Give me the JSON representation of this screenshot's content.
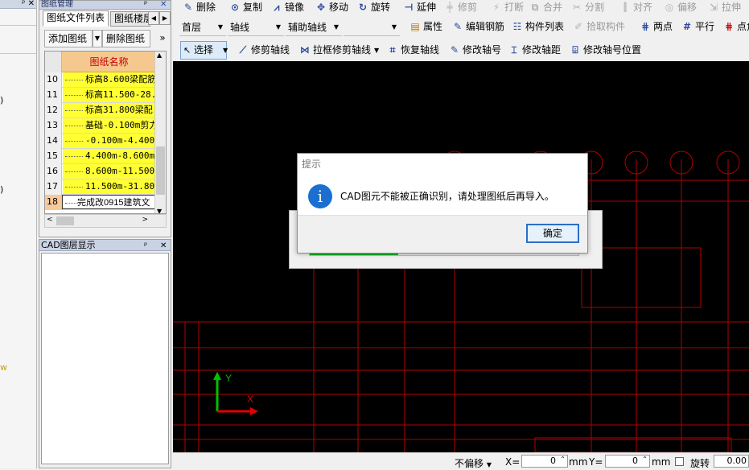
{
  "left_panel": {
    "fragments": [
      ")",
      ")",
      "w"
    ]
  },
  "drawing_panel": {
    "title": "图纸管理",
    "pin": "ᵖ",
    "close": "✕",
    "tabs": [
      "图纸文件列表",
      "图纸楼层"
    ],
    "add_label": "添加图纸",
    "delete_label": "删除图纸",
    "more": "»",
    "header": "图纸名称",
    "rows": [
      {
        "num": "10",
        "name": "标高8.600梁配筋"
      },
      {
        "num": "11",
        "name": "标高11.500-28."
      },
      {
        "num": "12",
        "name": "标高31.800梁配"
      },
      {
        "num": "13",
        "name": "基础-0.100m剪力"
      },
      {
        "num": "14",
        "name": "-0.100m-4.400M"
      },
      {
        "num": "15",
        "name": "4.400m-8.600m剪"
      },
      {
        "num": "16",
        "name": "8.600m-11.500m"
      },
      {
        "num": "17",
        "name": "11.500m-31.800"
      },
      {
        "num": "18",
        "name": "完成改0915建筑文"
      }
    ]
  },
  "layer_panel": {
    "title": "CAD图层显示"
  },
  "toolbar1": {
    "items": [
      "删除",
      "复制",
      "镜像",
      "移动",
      "旋转",
      "延伸",
      "修剪",
      "打断",
      "合并",
      "分割",
      "对齐",
      "偏移",
      "拉伸"
    ]
  },
  "toolbar2": {
    "floor": "首层",
    "category": "轴线",
    "type": "辅助轴线",
    "blank": "",
    "items": [
      "属性",
      "编辑钢筋",
      "构件列表",
      "拾取构件",
      "两点",
      "平行",
      "点角"
    ]
  },
  "toolbar3": {
    "select": "选择",
    "items": [
      "修剪轴线",
      "拉框修剪轴线",
      "恢复轴线",
      "修改轴号",
      "修改轴距",
      "修改轴号位置"
    ]
  },
  "canvas": {
    "axis_x": "X",
    "axis_y": "Y"
  },
  "dialog": {
    "title": "提示",
    "message": "CAD图元不能被正确识别，请处理图纸后再导入。",
    "ok": "确定"
  },
  "progress": {
    "value": 0.33
  },
  "status": {
    "mode": "不偏移",
    "x_label": "X=",
    "x_value": "0",
    "unit1": "mm",
    "y_label": "Y=",
    "y_value": "0",
    "unit2": "mm",
    "rotate_label": "旋转",
    "rotate_value": "0.00"
  },
  "colors": {
    "accent": "#1a6fd1",
    "grid_yellow": "#ffff33",
    "header_orange": "#f4c88e",
    "cad_red": "#b30000",
    "progress_green": "#06b025"
  }
}
